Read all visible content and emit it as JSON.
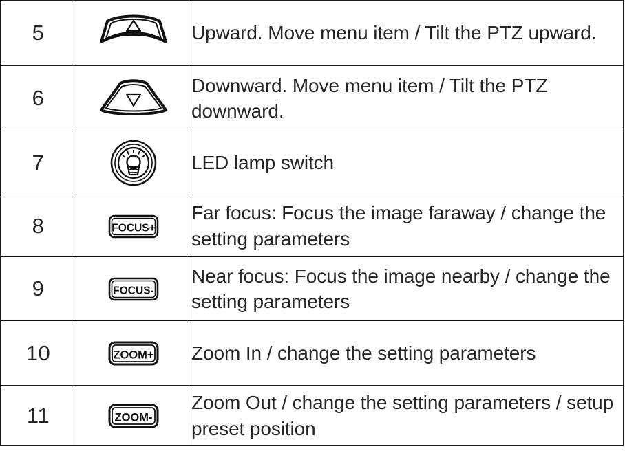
{
  "table": {
    "columns": [
      "number",
      "icon",
      "description"
    ],
    "rows": [
      {
        "number": "5",
        "icon_name": "up-arrow-fan-button-icon",
        "icon_label": "",
        "description": "Upward. Move menu item / Tilt the PTZ upward."
      },
      {
        "number": "6",
        "icon_name": "down-arrow-fan-button-icon",
        "icon_label": "",
        "description": "Downward. Move menu item / Tilt the PTZ downward."
      },
      {
        "number": "7",
        "icon_name": "led-lamp-switch-icon",
        "icon_label": "",
        "description": "LED lamp switch"
      },
      {
        "number": "8",
        "icon_name": "focus-plus-button-icon",
        "icon_label": "FOCUS+",
        "description": "Far focus: Focus the image faraway / change the setting parameters"
      },
      {
        "number": "9",
        "icon_name": "focus-minus-button-icon",
        "icon_label": "FOCUS-",
        "description": "Near focus: Focus the image nearby / change the setting parameters"
      },
      {
        "number": "10",
        "icon_name": "zoom-plus-button-icon",
        "icon_label": "ZOOM+",
        "description": "Zoom In / change the setting parameters"
      },
      {
        "number": "11",
        "icon_name": "zoom-minus-button-icon",
        "icon_label": "ZOOM-",
        "description": "Zoom Out / change the setting parameters / setup preset position"
      }
    ]
  },
  "colors": {
    "border": "#1a1a1a",
    "text": "#262626",
    "icon_stroke": "#111111",
    "background": "#ffffff"
  }
}
